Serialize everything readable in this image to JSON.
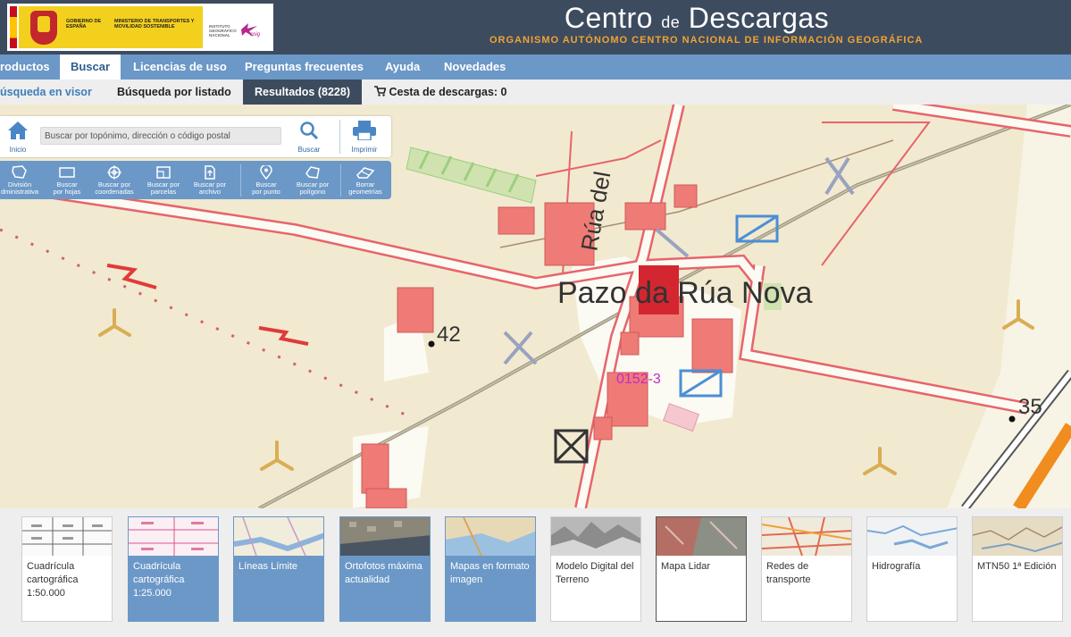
{
  "header": {
    "logos": {
      "gobierno": "GOBIERNO DE ESPAÑA",
      "ministerio": "MINISTERIO DE TRANSPORTES Y MOVILIDAD SOSTENIBLE",
      "ign": "INSTITUTO GEOGRÁFICO NACIONAL",
      "cnig": "cnig"
    },
    "title_main_1": "Centro",
    "title_de": "de",
    "title_main_2": "Descargas",
    "subtitle": "Organismo Autónomo Centro Nacional de Información Geográfica",
    "colors": {
      "header_bg": "#3d4b5f",
      "accent": "#f0a432",
      "nav_bg": "#6b98c7"
    }
  },
  "main_nav": {
    "items": [
      "roductos",
      "Buscar",
      "Licencias de uso",
      "Preguntas frecuentes",
      "Ayuda",
      "Novedades"
    ],
    "active": "Buscar"
  },
  "sub_nav": {
    "visor": "úsqueda en visor",
    "listado": "Búsqueda por listado",
    "resultados": "Resultados (8228)",
    "cesta": "Cesta de descargas: 0"
  },
  "toolbar": {
    "home_label": "Inicio",
    "search_placeholder": "Buscar por topónimo, dirección o código postal",
    "search_label": "Buscar",
    "print_label": "Imprimir",
    "tools": [
      {
        "line1": "División",
        "line2": "dministrativa",
        "icon": "administrative-division-icon"
      },
      {
        "line1": "Buscar",
        "line2": "por hojas",
        "icon": "sheet-icon"
      },
      {
        "line1": "Buscar por",
        "line2": "coordenadas",
        "icon": "crosshair-icon"
      },
      {
        "line1": "Buscar por",
        "line2": "parcelas",
        "icon": "parcel-icon"
      },
      {
        "line1": "Buscar por",
        "line2": "archivo",
        "icon": "file-upload-icon"
      },
      {
        "line1": "Buscar",
        "line2": "por punto",
        "icon": "point-marker-icon"
      },
      {
        "line1": "Buscar por",
        "line2": "polígono",
        "icon": "polygon-icon"
      },
      {
        "line1": "Borrar",
        "line2": "geometrías",
        "icon": "eraser-icon"
      }
    ]
  },
  "map": {
    "place_name": "Pazo da Rúa Nova",
    "street_name": "Rúa del",
    "elevation_1": "42",
    "elevation_2": "35",
    "sheet_label": "0152-3"
  },
  "products": [
    {
      "label": "Cuadrícula cartográfica 1:50.000",
      "style": "white"
    },
    {
      "label": "Cuadrícula cartográfica 1:25.000",
      "style": "blue"
    },
    {
      "label": "Líneas Límite",
      "style": "blue"
    },
    {
      "label": "Ortofotos máxima actualidad",
      "style": "blue"
    },
    {
      "label": "Mapas en formato imagen",
      "style": "blue"
    },
    {
      "label": "Modelo Digital del Terreno",
      "style": "white"
    },
    {
      "label": "Mapa Lidar",
      "style": "selected"
    },
    {
      "label": "Redes de transporte",
      "style": "white"
    },
    {
      "label": "Hidrografía",
      "style": "white"
    },
    {
      "label": "MTN50 1ª Edición",
      "style": "white"
    }
  ]
}
